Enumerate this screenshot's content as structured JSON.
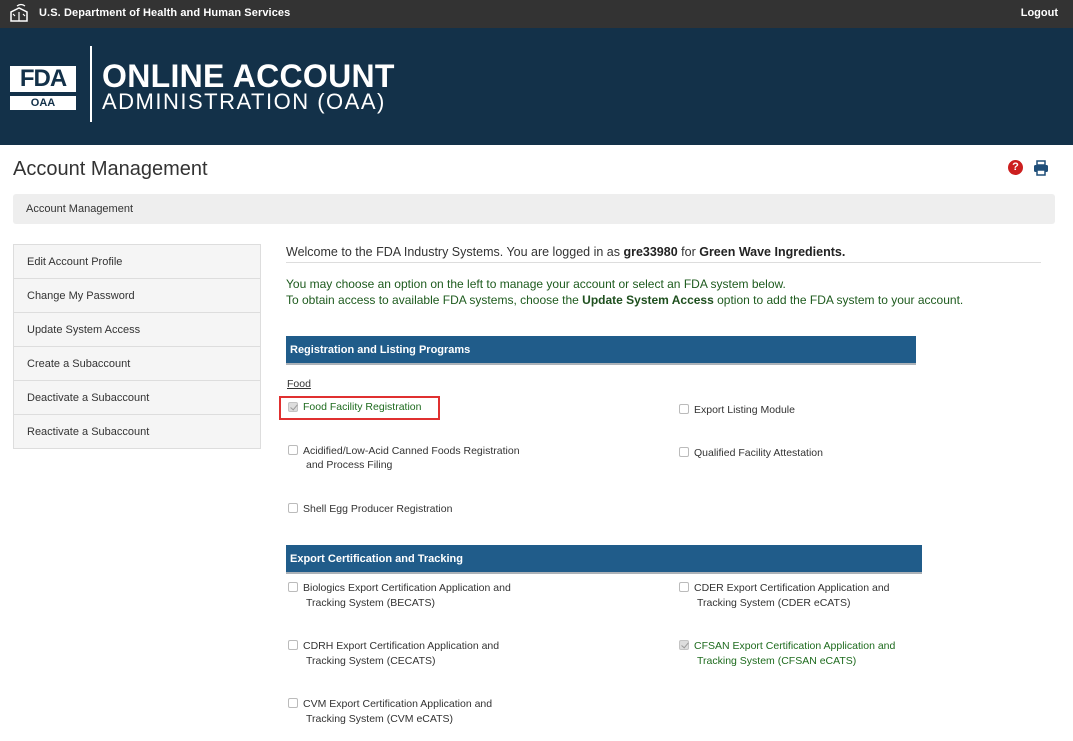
{
  "topbar": {
    "agency": "U.S. Department of Health and Human Services",
    "logout": "Logout"
  },
  "banner": {
    "logo_top": "FDA",
    "logo_bottom": "OAA",
    "title_line1": "ONLINE ACCOUNT",
    "title_line2": "ADMINISTRATION (OAA)"
  },
  "page": {
    "title": "Account Management",
    "help_icon": "?",
    "breadcrumb": "Account Management"
  },
  "sidebar": {
    "items": [
      {
        "label": "Edit Account Profile"
      },
      {
        "label": "Change My Password"
      },
      {
        "label": "Update System Access"
      },
      {
        "label": "Create a Subaccount"
      },
      {
        "label": "Deactivate a Subaccount"
      },
      {
        "label": "Reactivate a Subaccount"
      }
    ]
  },
  "main": {
    "welcome_prefix": "Welcome to the FDA Industry Systems. You are logged in as ",
    "username": "gre33980",
    "welcome_mid": " for ",
    "company": "Green Wave Ingredients.",
    "info_line1": "You may choose an option on the left to manage your account or select an FDA system below.",
    "info_line2_prefix": "To obtain access to available FDA systems, choose the ",
    "info_line2_bold": "Update System Access",
    "info_line2_suffix": " option to add the FDA system to your account."
  },
  "sections": {
    "registration": {
      "title": "Registration and Listing Programs",
      "subhead": "Food",
      "options": {
        "food_facility": {
          "label": "Food Facility Registration",
          "checked": true
        },
        "export_listing": {
          "label": "Export Listing Module",
          "checked": false
        },
        "acidified_l1": "Acidified/Low-Acid Canned Foods Registration",
        "acidified_l2": "and Process Filing",
        "qualified_facility": {
          "label": "Qualified Facility Attestation",
          "checked": false
        },
        "shell_egg": {
          "label": "Shell Egg Producer Registration",
          "checked": false
        }
      }
    },
    "export": {
      "title": "Export Certification and Tracking",
      "options": {
        "becats_l1": "Biologics Export Certification Application and",
        "becats_l2": "Tracking System (BECATS)",
        "cder_l1": "CDER Export Certification Application and",
        "cder_l2": "Tracking System (CDER eCATS)",
        "cdrh_l1": "CDRH Export Certification Application and",
        "cdrh_l2": "Tracking System (CECATS)",
        "cfsan_l1": "CFSAN Export Certification Application and",
        "cfsan_l2": "Tracking System (CFSAN eCATS)",
        "cvm_l1": "CVM Export Certification Application and",
        "cvm_l2": "Tracking System (CVM eCATS)"
      }
    }
  },
  "colors": {
    "topbar": "#333333",
    "banner": "#133149",
    "section_header": "#205c8a",
    "green_text": "#1e6b1e",
    "highlight": "#e03030"
  }
}
